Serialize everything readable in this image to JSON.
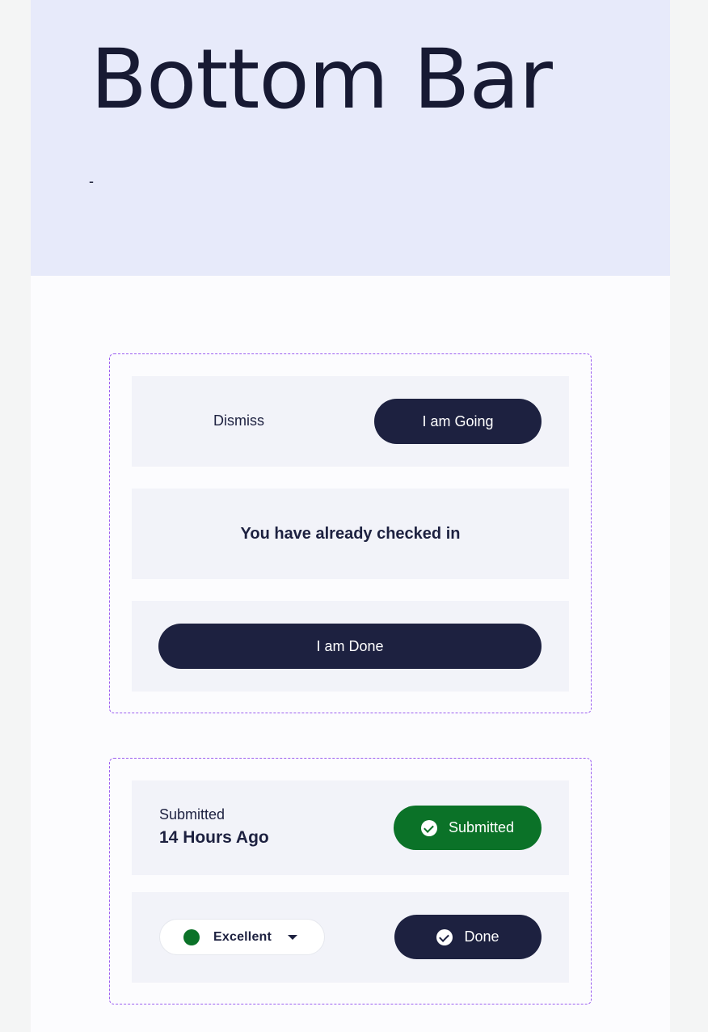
{
  "header": {
    "title": "Bottom Bar",
    "subtitle": "-"
  },
  "group_1": {
    "bar_1": {
      "dismiss_label": "Dismiss",
      "going_label": "I am Going"
    },
    "bar_2": {
      "message": "You have already checked in"
    },
    "bar_3": {
      "done_label": "I am Done"
    }
  },
  "group_2": {
    "bar_1": {
      "status_label": "Submitted",
      "status_time": "14 Hours Ago",
      "submitted_button_label": "Submitted",
      "icon": "check-circle-icon"
    },
    "bar_2": {
      "rating_value": "Excellent",
      "rating_color": "#0b7228",
      "done_label": "Done",
      "icon": "check-circle-icon"
    }
  },
  "colors": {
    "primary_dark": "#1d2140",
    "success_green": "#0b7228",
    "hero_bg": "#e7eafa",
    "bar_bg": "#f2f3f9",
    "dashed_border": "#9b5ef0"
  }
}
